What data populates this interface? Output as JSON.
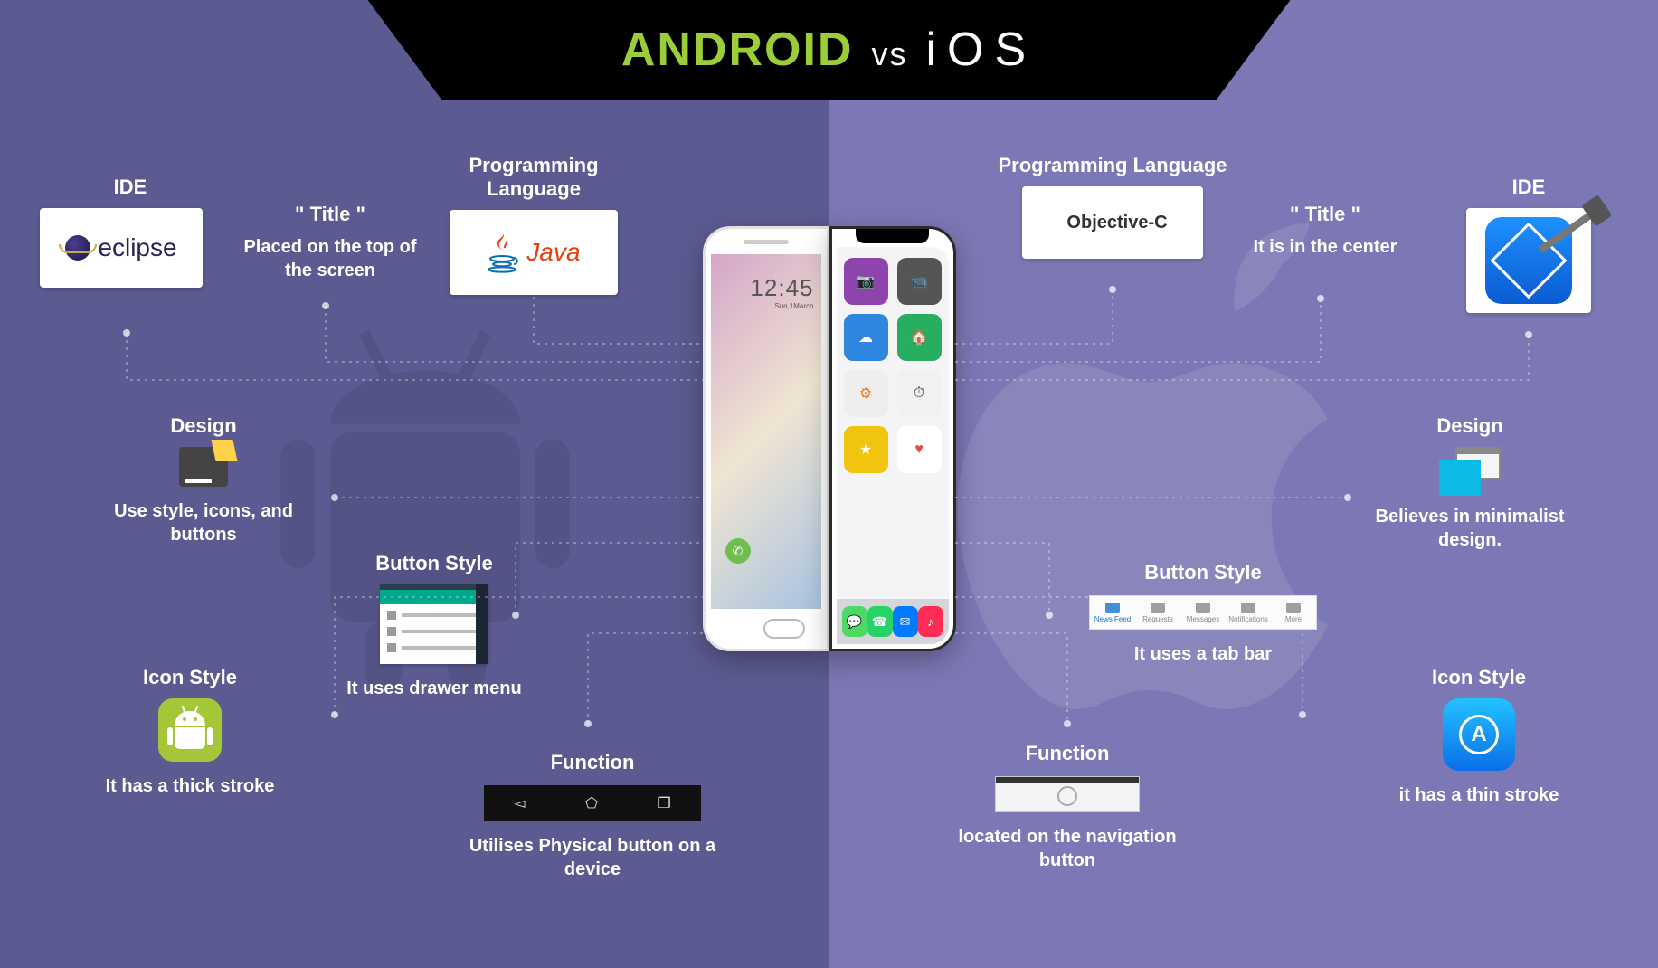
{
  "banner": {
    "android": "ANDROID",
    "vs": "vs",
    "ios": "iOS"
  },
  "left": {
    "ide": {
      "title": "IDE",
      "brand": "eclipse"
    },
    "titleNode": {
      "title": "\" Title \"",
      "desc": "Placed on the top of the screen"
    },
    "lang": {
      "title": "Programming Language",
      "brand": "Java"
    },
    "design": {
      "title": "Design",
      "desc": "Use style, icons, and buttons"
    },
    "button": {
      "title": "Button Style",
      "desc": "It uses drawer menu"
    },
    "icon": {
      "title": "Icon Style",
      "desc": "It has a thick stroke"
    },
    "func": {
      "title": "Function",
      "desc": "Utilises Physical button on a device"
    }
  },
  "right": {
    "lang": {
      "title": "Programming Language",
      "brand": "Objective-C"
    },
    "titleNode": {
      "title": "\" Title \"",
      "desc": "It is in the center"
    },
    "ide": {
      "title": "IDE"
    },
    "design": {
      "title": "Design",
      "desc": "Believes in minimalist design."
    },
    "button": {
      "title": "Button Style",
      "desc": "It uses a tab bar"
    },
    "icon": {
      "title": "Icon Style",
      "desc": "it has a thin stroke"
    },
    "func": {
      "title": "Function",
      "desc": "located on the navigation button"
    }
  },
  "phoneLeft": {
    "time": "12:45",
    "date": "Sun,1March"
  },
  "tabBar": [
    "News Feed",
    "Requests",
    "Messages",
    "Notifications",
    "More"
  ]
}
